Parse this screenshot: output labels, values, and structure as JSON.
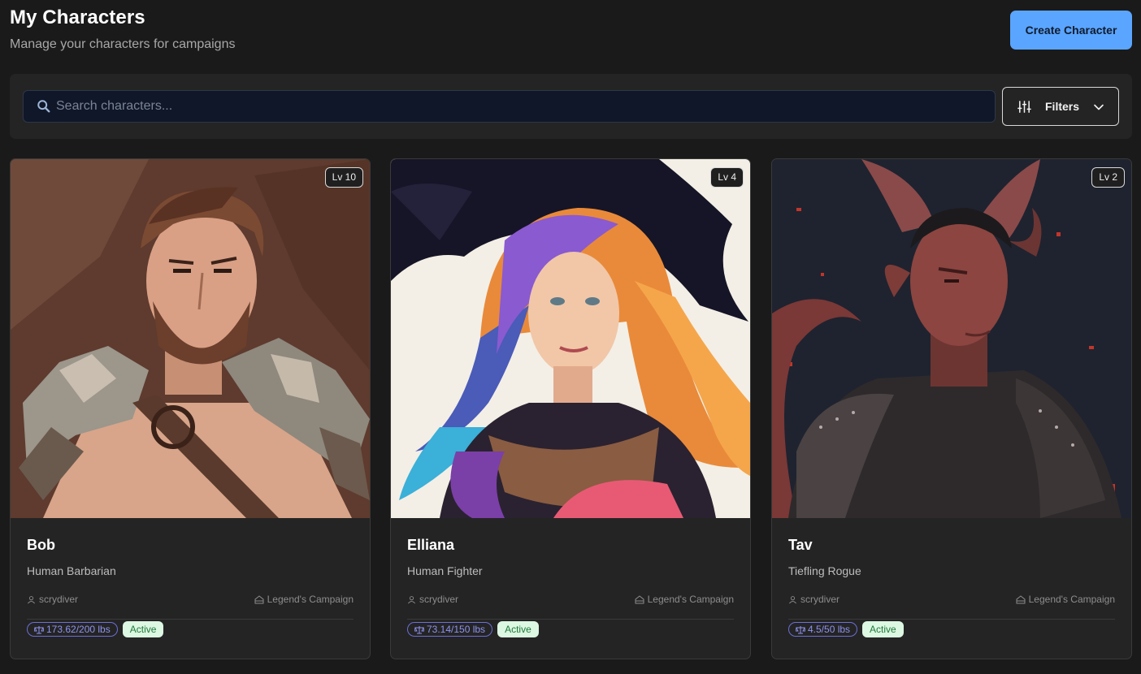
{
  "header": {
    "title": "My Characters",
    "subtitle": "Manage your characters for campaigns",
    "create_label": "Create Character"
  },
  "search": {
    "placeholder": "Search characters...",
    "value": ""
  },
  "filters": {
    "label": "Filters"
  },
  "characters": [
    {
      "name": "Bob",
      "class": "Human Barbarian",
      "level": "Lv 10",
      "owner": "scrydiver",
      "campaign": "Legend's Campaign",
      "weight": "173.62/200 lbs",
      "status": "Active",
      "portrait": "barbarian-portrait"
    },
    {
      "name": "Elliana",
      "class": "Human Fighter",
      "level": "Lv 4",
      "owner": "scrydiver",
      "campaign": "Legend's Campaign",
      "weight": "73.14/150 lbs",
      "status": "Active",
      "portrait": "fighter-portrait"
    },
    {
      "name": "Tav",
      "class": "Tiefling Rogue",
      "level": "Lv 2",
      "owner": "scrydiver",
      "campaign": "Legend's Campaign",
      "weight": "4.5/50 lbs",
      "status": "Active",
      "portrait": "rogue-portrait"
    }
  ],
  "colors": {
    "background": "#1a1a1a",
    "panel": "#242424",
    "accent": "#5aa5ff",
    "weight_badge": "#8f93f0",
    "active_badge_bg": "#dcf7e2",
    "active_badge_text": "#1f7a3a"
  },
  "icons": {
    "search": "search-icon",
    "filters": "sliders-icon",
    "dropdown": "chevron-down-icon",
    "owner": "user-icon",
    "campaign": "campaign-icon",
    "weight": "scale-icon"
  }
}
